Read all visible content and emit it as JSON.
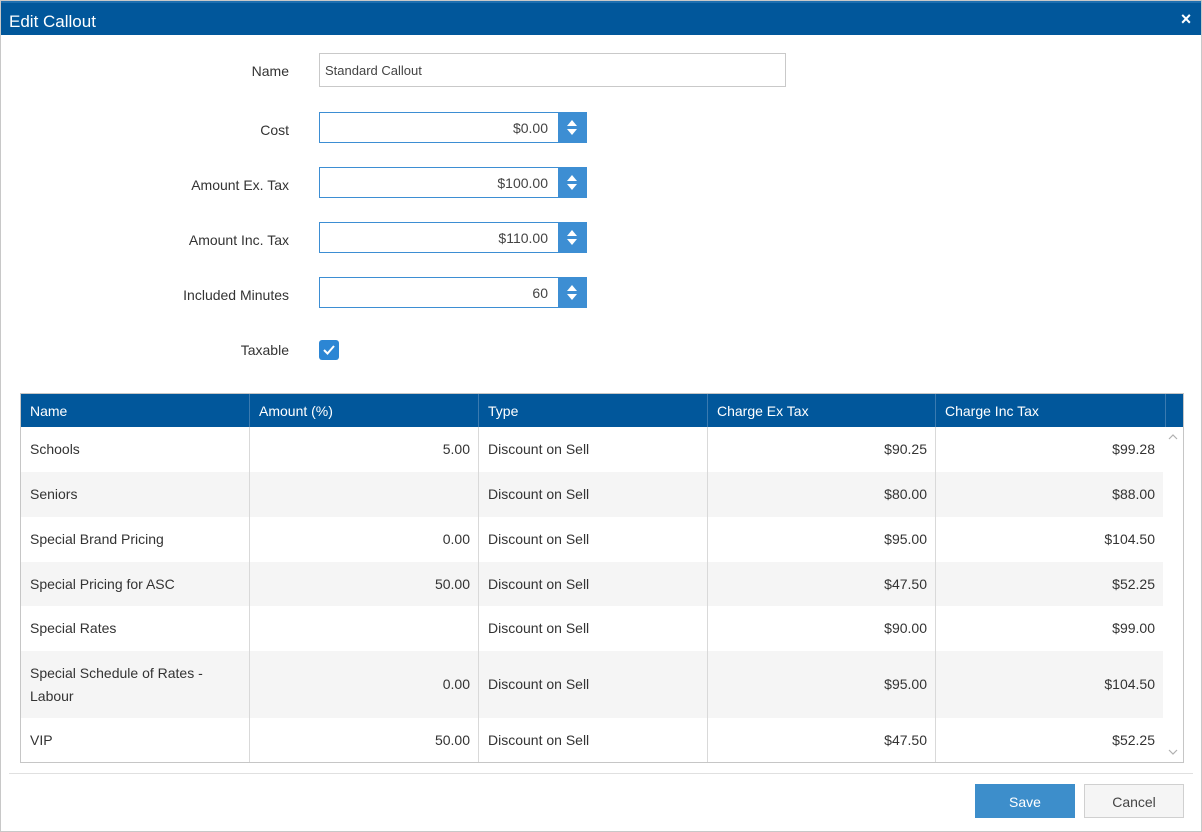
{
  "dialog": {
    "title": "Edit Callout",
    "close_glyph": "×"
  },
  "form": {
    "name_label": "Name",
    "name_value": "Standard Callout",
    "cost_label": "Cost",
    "cost_value": "$0.00",
    "amount_ex_label": "Amount Ex. Tax",
    "amount_ex_value": "$100.00",
    "amount_inc_label": "Amount Inc. Tax",
    "amount_inc_value": "$110.00",
    "minutes_label": "Included Minutes",
    "minutes_value": "60",
    "taxable_label": "Taxable",
    "taxable_checked": true
  },
  "grid": {
    "columns": [
      "Name",
      "Amount (%)",
      "Type",
      "Charge Ex Tax",
      "Charge Inc Tax"
    ],
    "rows": [
      {
        "name": "Schools",
        "amount": "5.00",
        "type": "Discount on Sell",
        "ex": "$90.25",
        "inc": "$99.28"
      },
      {
        "name": "Seniors",
        "amount": "",
        "type": "Discount on Sell",
        "ex": "$80.00",
        "inc": "$88.00"
      },
      {
        "name": "Special Brand Pricing",
        "amount": "0.00",
        "type": "Discount on Sell",
        "ex": "$95.00",
        "inc": "$104.50"
      },
      {
        "name": "Special Pricing for ASC",
        "amount": "50.00",
        "type": "Discount on Sell",
        "ex": "$47.50",
        "inc": "$52.25"
      },
      {
        "name": "Special Rates",
        "amount": "",
        "type": "Discount on Sell",
        "ex": "$90.00",
        "inc": "$99.00"
      },
      {
        "name": "Special Schedule of Rates - Labour",
        "amount": "0.00",
        "type": "Discount on Sell",
        "ex": "$95.00",
        "inc": "$104.50"
      },
      {
        "name": "VIP",
        "amount": "50.00",
        "type": "Discount on Sell",
        "ex": "$47.50",
        "inc": "$52.25"
      }
    ]
  },
  "footer": {
    "save_label": "Save",
    "cancel_label": "Cancel"
  },
  "colors": {
    "header_blue": "#01579b",
    "accent_blue": "#3d8ed3",
    "row_alt": "#f5f5f5"
  }
}
